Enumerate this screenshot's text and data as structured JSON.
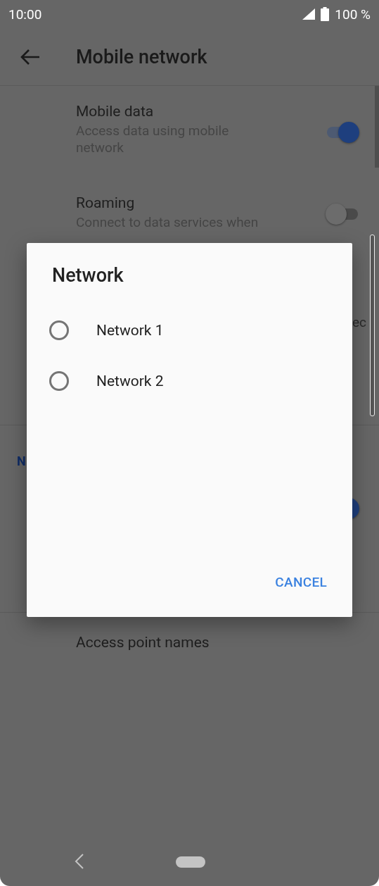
{
  "status_bar": {
    "time": "10:00",
    "battery": "100 %"
  },
  "app_bar": {
    "title": "Mobile network"
  },
  "settings": [
    {
      "kind": "switch",
      "title": "Mobile data",
      "summary": "Access data using mobile network",
      "on": true
    },
    {
      "kind": "switch",
      "title": "Roaming",
      "summary": "Connect to data services when",
      "on": false
    },
    {
      "kind": "text",
      "summary": "ec"
    },
    {
      "kind": "header",
      "title": "N"
    },
    {
      "kind": "switch",
      "on": true
    },
    {
      "kind": "link",
      "title": "Access point names"
    }
  ],
  "dialog": {
    "title": "Network",
    "options": [
      {
        "label": "Network 1",
        "selected": false
      },
      {
        "label": "Network 2",
        "selected": false
      }
    ],
    "buttons": [
      "CANCEL"
    ]
  }
}
